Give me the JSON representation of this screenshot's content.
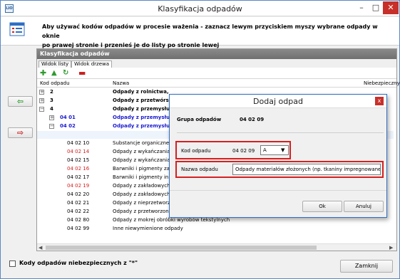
{
  "window": {
    "title": "Klasyfikacja odpadów",
    "icon_label": "LIO",
    "min": "–",
    "max": "□",
    "close": "✕"
  },
  "header": {
    "line1": "Aby używać kodów odpadów w procesie ważenia - zaznacz lewym przyciskiem myszy wybrane odpady w oknie",
    "line2": "po prawej stronie i przenieś je do listy po stronie lewej"
  },
  "nav": {
    "add_icon": "⇦",
    "remove_icon": "⇨"
  },
  "panel": {
    "title": "Klasyfikacja odpadów",
    "tabs": [
      "Widok listy",
      "Widok drzewa"
    ],
    "toolbar_icons": [
      "add-icon",
      "warning-icon",
      "refresh-icon",
      "remove-icon"
    ],
    "columns": {
      "code": "Kod odpadu",
      "name": "Nazwa",
      "danger": "Niebezpieczny"
    }
  },
  "rows": [
    {
      "code": "2",
      "name": "Odpady z rolnictwa,",
      "style": "bold",
      "indent": 0,
      "expander": "+"
    },
    {
      "code": "3",
      "name": "Odpady z przetwórs",
      "style": "bold",
      "indent": 0,
      "expander": "+"
    },
    {
      "code": "4",
      "name": "Odpady z przemysłu",
      "style": "bold",
      "indent": 0,
      "expander": "−"
    },
    {
      "code": "04 01",
      "name": "Odpady z przemysłu",
      "style": "blue",
      "indent": 1,
      "expander": "+"
    },
    {
      "code": "04 02",
      "name": "Odpady z przemysłu",
      "style": "blue",
      "indent": 1,
      "expander": "−"
    },
    {
      "code": "",
      "name": "",
      "style": "",
      "indent": 2,
      "expander": ""
    },
    {
      "code": "04 02 10",
      "name": "Substancje organiczne",
      "style": "",
      "indent": 2,
      "expander": ""
    },
    {
      "code": "04 02 14",
      "name": "Odpady z wykańczania",
      "style": "red",
      "indent": 2,
      "expander": ""
    },
    {
      "code": "04 02 15",
      "name": "Odpady z wykańczania",
      "style": "",
      "indent": 2,
      "expander": ""
    },
    {
      "code": "04 02 16",
      "name": "Barwniki i pigmenty zaw",
      "style": "red",
      "indent": 2,
      "expander": ""
    },
    {
      "code": "04 02 17",
      "name": "Barwniki i pigmenty inne",
      "style": "",
      "indent": 2,
      "expander": ""
    },
    {
      "code": "04 02 19",
      "name": "Odpady z zakładowych",
      "style": "red",
      "indent": 2,
      "expander": ""
    },
    {
      "code": "04 02 20",
      "name": "Odpady z zakładowych",
      "style": "",
      "indent": 2,
      "expander": ""
    },
    {
      "code": "04 02 21",
      "name": "Odpady z nieprzetworz",
      "style": "",
      "indent": 2,
      "expander": ""
    },
    {
      "code": "04 02 22",
      "name": "Odpady z przetworzonych włókien tekstylnych",
      "style": "",
      "indent": 2,
      "expander": ""
    },
    {
      "code": "04 02 80",
      "name": "Odpady z mokrej obróbki wyrobów tekstylnych",
      "style": "",
      "indent": 2,
      "expander": ""
    },
    {
      "code": "04 02 99",
      "name": "Inne niewymienione odpady",
      "style": "",
      "indent": 2,
      "expander": ""
    }
  ],
  "footer": {
    "checkbox_label": "Kody odpadów niebezpiecznych z \"*\"",
    "close_label": "Zamknij"
  },
  "dialog": {
    "title": "Dodaj odpad",
    "close": "x",
    "group_label": "Grupa odpadów",
    "group_value": "04 02 09",
    "code_label": "Kod odpadu",
    "code_value": "04 02 09",
    "select_value": "A",
    "name_label": "Nazwa odpadu",
    "name_value": "Odpady materiałów złożonych (np. tkaniny impregnowane, ela",
    "ok": "Ok",
    "cancel": "Anuluj"
  },
  "colors": {
    "accent": "#2e6ec4",
    "red": "#d62020",
    "blue": "#1a1ad1",
    "green": "#2e9a2e"
  }
}
